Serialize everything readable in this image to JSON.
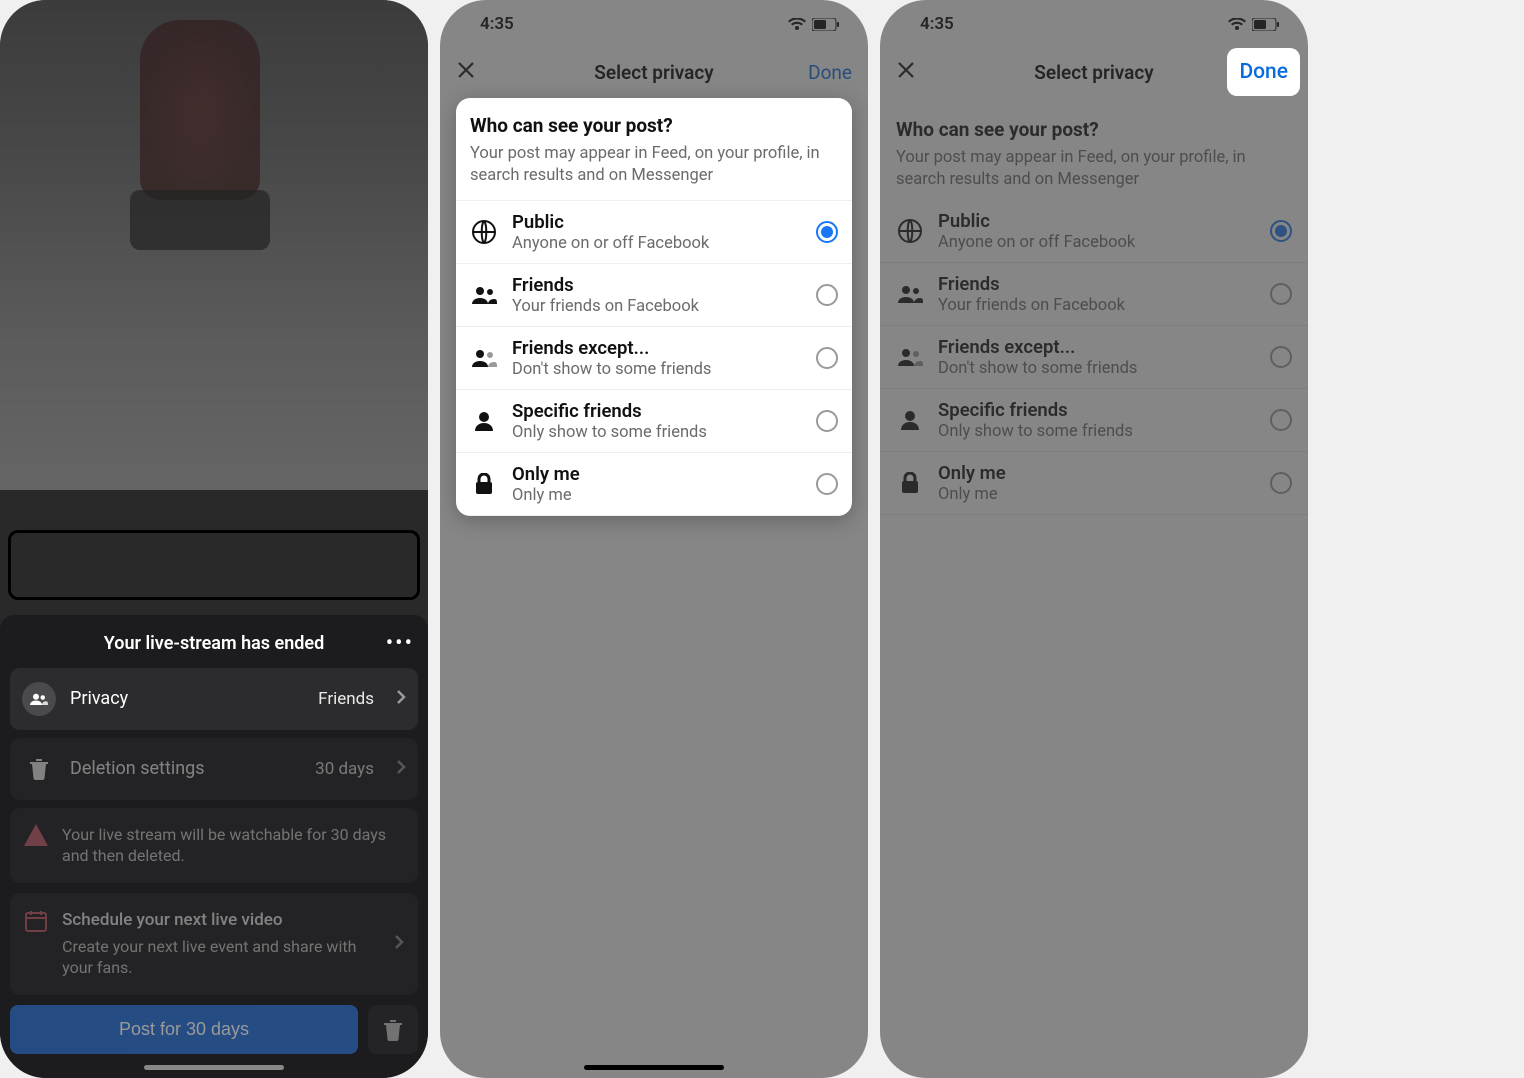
{
  "status": {
    "time": "4:35"
  },
  "screen1": {
    "title": "Your live-stream has ended",
    "rows": {
      "privacy": {
        "label": "Privacy",
        "value": "Friends"
      },
      "deletion": {
        "label": "Deletion settings",
        "value": "30 days"
      }
    },
    "warning": "Your live stream will be watchable for 30 days and then deleted.",
    "schedule": {
      "title": "Schedule your next live video",
      "sub": "Create your next live event and share with your fans."
    },
    "post_button": "Post for 30 days"
  },
  "privacy_selector": {
    "header_title": "Select privacy",
    "done": "Done",
    "card_title": "Who can see your post?",
    "card_sub": "Your post may appear in Feed, on your profile, in search results and on Messenger",
    "options": [
      {
        "title": "Public",
        "sub": "Anyone on or off Facebook",
        "selected": true
      },
      {
        "title": "Friends",
        "sub": "Your friends on Facebook",
        "selected": false
      },
      {
        "title": "Friends except...",
        "sub": "Don't show to some friends",
        "selected": false
      },
      {
        "title": "Specific friends",
        "sub": "Only show to some friends",
        "selected": false
      },
      {
        "title": "Only me",
        "sub": "Only me",
        "selected": false
      }
    ]
  }
}
